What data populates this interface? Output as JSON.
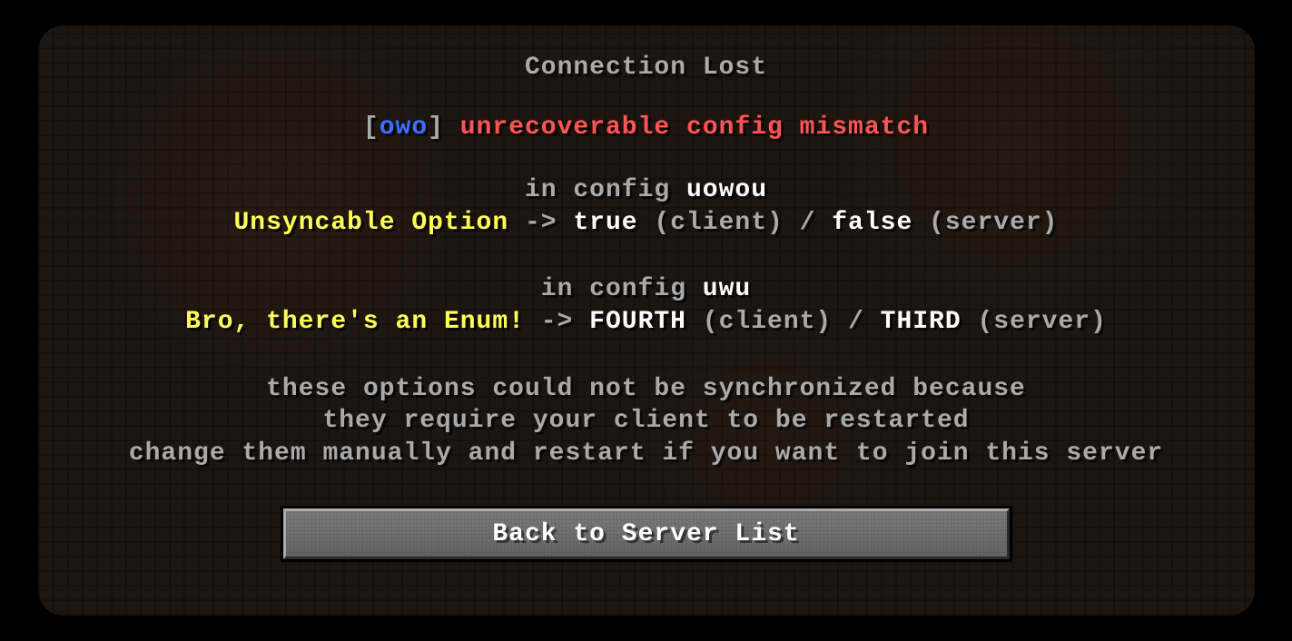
{
  "title": "Connection Lost",
  "mismatch": {
    "bracket_open": "[",
    "tag": "owo",
    "bracket_close": "]",
    "message": "unrecoverable config mismatch"
  },
  "configs": [
    {
      "in_config_prefix": "in config ",
      "config_name": "uowou",
      "option_name": "Unsyncable Option",
      "arrow": " -> ",
      "client_value": "true",
      "client_label": " (client) ",
      "slash": "/ ",
      "server_value": "false",
      "server_label": " (server)"
    },
    {
      "in_config_prefix": "in config ",
      "config_name": "uwu",
      "option_name": "Bro, there's an Enum!",
      "arrow": " -> ",
      "client_value": "FOURTH",
      "client_label": " (client) ",
      "slash": "/ ",
      "server_value": "THIRD",
      "server_label": " (server)"
    }
  ],
  "footer": {
    "line1": "these options could not be synchronized because",
    "line2": "they require your client to be restarted",
    "line3": "change them manually and restart if you want to join this server"
  },
  "button": {
    "label": "Back to Server List"
  }
}
